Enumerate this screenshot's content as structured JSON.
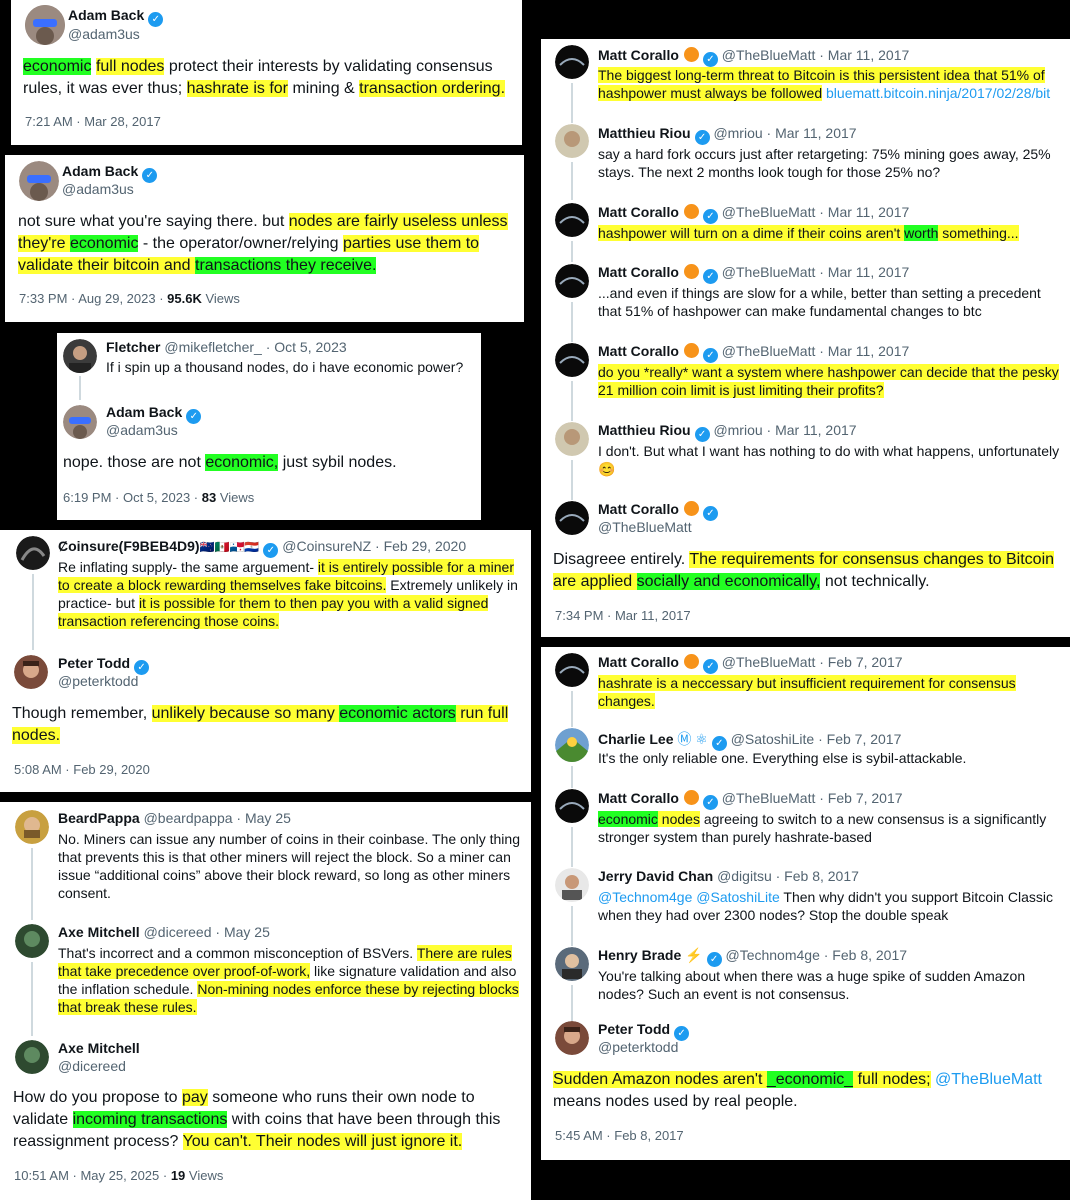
{
  "panels": {
    "p1": {
      "name": "Adam Back",
      "handle": "@adam3us",
      "t1": "economic",
      "t2": " ",
      "t3": "full nodes",
      "t4": " protect their interests by validating consensus rules, it was ever thus; ",
      "t5": "hashrate is for",
      "t6": " mining & ",
      "t7": "transaction ordering.",
      "time": "7:21 AM · Mar 28, 2017"
    },
    "p2": {
      "name": "Adam Back",
      "handle": "@adam3us",
      "t1": "not sure what you're saying there. but ",
      "t2": "nodes are fairly useless unless they're ",
      "t3": "economic",
      "t4": " - the operator/owner/relying ",
      "t5": "parties use them to validate their bitcoin and ",
      "t6": "transactions they receive.",
      "time": "7:33 PM · Aug 29, 2023 · ",
      "views": "95.6K",
      "views_label": " Views"
    },
    "p3": {
      "r_name": "Fletcher",
      "r_handle": "@mikefletcher_ · Oct 5, 2023",
      "r_text": "If i spin up a thousand nodes, do i have economic power?",
      "name": "Adam Back",
      "handle": "@adam3us",
      "t1": "nope. those are not ",
      "t2": "economic,",
      "t3": " just sybil nodes.",
      "time": "6:19 PM · Oct 5, 2023 · ",
      "views": "83",
      "views_label": " Views"
    },
    "p4": {
      "r_name": "Ȼoinsure(F9BEB4D9)",
      "r_flags": "🇳🇿🇲🇽🇵🇦🇵🇾",
      "r_handle": "@CoinsureNZ · Feb 29, 2020",
      "r1": "Re inflating supply- the same arguement- ",
      "r2": "it is entirely possible for a miner to create a block rewarding themselves fake bitcoins.",
      "r3": " Extremely unlikely in practice- but ",
      "r4": "it is possible for them to then pay you with a valid signed transaction referencing those coins.",
      "name": "Peter Todd",
      "handle": "@peterktodd",
      "t1": "Though remember, ",
      "t2": "unlikely because so many ",
      "t3": "economic actors",
      "t4": " run full nodes.",
      "time": "5:08 AM · Feb 29, 2020"
    },
    "p5": {
      "a_name": "BeardPappa",
      "a_handle": "@beardpappa · May 25",
      "a_text": "No. Miners can issue any number of coins in their coinbase. The only thing that prevents this is that other miners will reject the block. So a miner can issue “additional coins” above their block reward, so long as other miners consent.",
      "b_name": "Axe Mitchell",
      "b_handle": "@dicereed · May 25",
      "b1": "That's incorrect and a common misconception of BSVers. ",
      "b2": "There are rules that take precedence over proof-of-work,",
      "b3": " like signature validation and also the inflation schedule. ",
      "b4": "Non-mining nodes enforce these by rejecting blocks that break these rules.",
      "name": "Axe Mitchell",
      "handle": "@dicereed",
      "t1": "How do you propose to ",
      "t2": "pay",
      "t3": " someone who runs their own node to validate ",
      "t4": "incoming transactions",
      "t5": " with coins that have been through this reassignment process? ",
      "t6": "You can't. Their nodes will just ignore it.",
      "time": "10:51 AM · May 25, 2025 · ",
      "views": "19",
      "views_label": " Views"
    },
    "p6": {
      "a_name": "Matt Corallo",
      "a_handle": "@TheBlueMatt · Mar 11, 2017",
      "a1": "The biggest long-term threat to Bitcoin is this persistent idea that 51% of hashpower must always be followed",
      "a2": " ",
      "a_link": "bluematt.bitcoin.ninja/2017/02/28/bit",
      "b_name": "Matthieu Riou",
      "b_handle": "@mriou · Mar 11, 2017",
      "b_text": "say a hard fork occurs just after retargeting: 75% mining goes away, 25% stays. The next 2 months look tough for those 25% no?",
      "c_name": "Matt Corallo",
      "c_handle": "@TheBlueMatt · Mar 11, 2017",
      "c1": "hashpower will turn on a dime if their coins aren't ",
      "c2": "worth",
      "c3": " something...",
      "d_name": "Matt Corallo",
      "d_handle": "@TheBlueMatt · Mar 11, 2017",
      "d_text": "...and even if things are slow for a while, better than setting a precedent that 51% of hashpower can make fundamental changes to btc",
      "e_name": "Matt Corallo",
      "e_handle": "@TheBlueMatt · Mar 11, 2017",
      "e_text": "do you *really* want a system where hashpower can decide that the pesky 21 million coin limit is just limiting their profits?",
      "f_name": "Matthieu Riou",
      "f_handle": "@mriou · Mar 11, 2017",
      "f_text": "I don't. But what I want has nothing to do with what happens, unfortunately",
      "f_emoji": "😊",
      "name": "Matt Corallo",
      "handle": "@TheBlueMatt",
      "t1": "Disagreee entirely. ",
      "t2": "The requirements for consensus changes to Bitcoin are applied ",
      "t3": "socially and economically,",
      "t4": " not technically.",
      "time": "7:34 PM · Mar 11, 2017"
    },
    "p7": {
      "a_name": "Matt Corallo",
      "a_handle": "@TheBlueMatt · Feb 7, 2017",
      "a_text": "hashrate is a neccessary but insufficient requirement for consensus changes.",
      "b_name": "Charlie Lee",
      "b_icons": "Ⓜ ⚛",
      "b_handle": "@SatoshiLite · Feb 7, 2017",
      "b_text": "It's the only reliable one. Everything else is sybil-attackable.",
      "c_name": "Matt Corallo",
      "c_handle": "@TheBlueMatt · Feb 7, 2017",
      "c1": "economic",
      "c2": " nodes",
      "c3": " agreeing to switch to a new consensus is a significantly stronger system than purely hashrate-based",
      "d_name": "Jerry David Chan",
      "d_handle": "@digitsu · Feb 8, 2017",
      "d_links": "@Technom4ge @SatoshiLite",
      "d_text": " Then why didn't you support Bitcoin Classic when they had over 2300 nodes? Stop the double speak",
      "e_name": "Henry Brade",
      "e_icon": "⚡",
      "e_handle": "@Technom4ge · Feb 8, 2017",
      "e_text": "You're talking about when there was a huge spike of sudden Amazon nodes? Such an event is not consensus.",
      "name": "Peter Todd",
      "handle": "@peterktodd",
      "t1": "Sudden Amazon nodes aren't ",
      "t2": "_economic_",
      "t3": " full nodes;",
      "t4": " ",
      "t5": "@TheBlueMatt",
      "t6": " means nodes used by real people.",
      "time": "5:45 AM · Feb 8, 2017"
    }
  },
  "colors": {
    "highlight_yellow": "#ffff33",
    "highlight_green": "#22ff22",
    "link": "#1d9bf0",
    "verified": "#1d9bf0",
    "bitcoin_orange": "#f7931a"
  },
  "icons": {
    "verified": "verified-badge-icon",
    "bitcoin": "bitcoin-orange-icon"
  }
}
